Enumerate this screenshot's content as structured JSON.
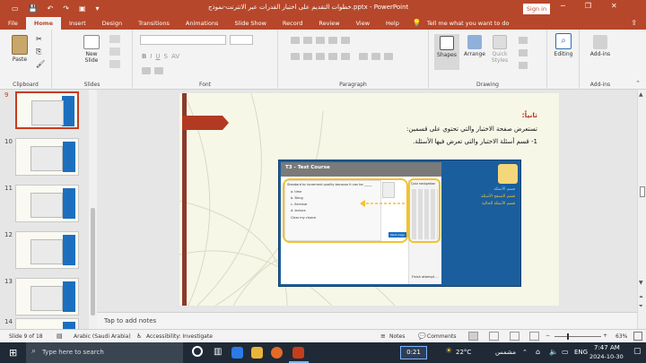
{
  "window": {
    "doc_title": "خطوات التقديم على اختبار القدرات عبر الانترنت-نموذج.pptx - PowerPoint",
    "signin_label": "Sign in"
  },
  "tabs": [
    "File",
    "Home",
    "Insert",
    "Design",
    "Transitions",
    "Animations",
    "Slide Show",
    "Record",
    "Review",
    "View",
    "Help"
  ],
  "active_tab": "Home",
  "tellme": "Tell me what you want to do",
  "ribbon": {
    "clipboard": {
      "paste": "Paste",
      "label": "Clipboard"
    },
    "slides": {
      "new_slide": "New Slide",
      "label": "Slides"
    },
    "font": {
      "label": "Font"
    },
    "paragraph": {
      "label": "Paragraph"
    },
    "drawing": {
      "shapes": "Shapes",
      "arrange": "Arrange",
      "quick_styles": "Quick Styles",
      "label": "Drawing"
    },
    "editing": {
      "editing": "Editing"
    },
    "addins": {
      "addins": "Add-ins",
      "label": "Add-ins"
    }
  },
  "thumbnails": [
    "9",
    "10",
    "11",
    "12",
    "13",
    "14"
  ],
  "slide": {
    "heading": "ثانياً:",
    "line1": "تستعرض صفحة الاختبار والتي تحتوي على قسمين:",
    "line2": "1- قسم أسئلة الاختبار والتي تعرض فيها الأسئلة.",
    "screenshot": {
      "course_title": "T3 - Test Course",
      "question_text": "Standard to increment quality because it can be _____",
      "options": [
        "a. time",
        "b. Bring",
        "c. Seminar",
        "d. lecture"
      ],
      "clear_choice": "Clear my choice",
      "nav_title": "Quiz navigation",
      "finish_label": "Finish attempt ...",
      "next_btn": "Next page",
      "right_lines": [
        "قسم الأسئلة",
        "قسم التصفح الأسئلة",
        "قسم الأسئلة الحالية"
      ]
    }
  },
  "notes_placeholder": "Tap to add notes",
  "status": {
    "slide_of": "Slide 9 of 18",
    "language": "Arabic (Saudi Arabia)",
    "accessibility": "Accessibility: Investigate",
    "notes": "Notes",
    "comments": "Comments",
    "zoom": "63%"
  },
  "taskbar": {
    "search_placeholder": "Type here to search",
    "timer": "0:21",
    "weather": "22°C",
    "weather_desc": "مشمس",
    "lang": "ENG",
    "time": "7:47 AM",
    "date": "2024-10-30"
  },
  "colors": {
    "accent": "#b7472a",
    "slide_blue": "#1c6fbf",
    "highlight": "#f2c230"
  }
}
